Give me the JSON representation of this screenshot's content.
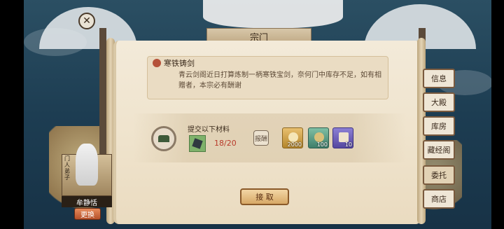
{
  "window": {
    "title": "宗门"
  },
  "notice": {
    "title": "寒铁铸剑",
    "text": "青云剑阁近日打算炼制一柄寒铁宝剑，奈何门中库存不足，如有相赠者，本宗必有酬谢"
  },
  "request": {
    "label": "提交以下材料",
    "material_count": "18/20",
    "reward_label": "报酬",
    "rewards": [
      {
        "icon": "stone-icon",
        "qty": "2000"
      },
      {
        "icon": "jade-token-icon",
        "qty": "100"
      },
      {
        "icon": "scroll-icon",
        "qty": "10"
      }
    ]
  },
  "accept_label": "接 取",
  "tabs": [
    "信息",
    "大殿",
    "库房",
    "藏经阁",
    "委托",
    "商店"
  ],
  "active_tab": "委托",
  "character": {
    "vertical_label": "门人弟子",
    "name": "牟静恬",
    "change_label": "更换"
  },
  "colors": {
    "parchment": "#efe3cc",
    "count_red": "#b83a2a",
    "change_button": "#d2693a"
  }
}
